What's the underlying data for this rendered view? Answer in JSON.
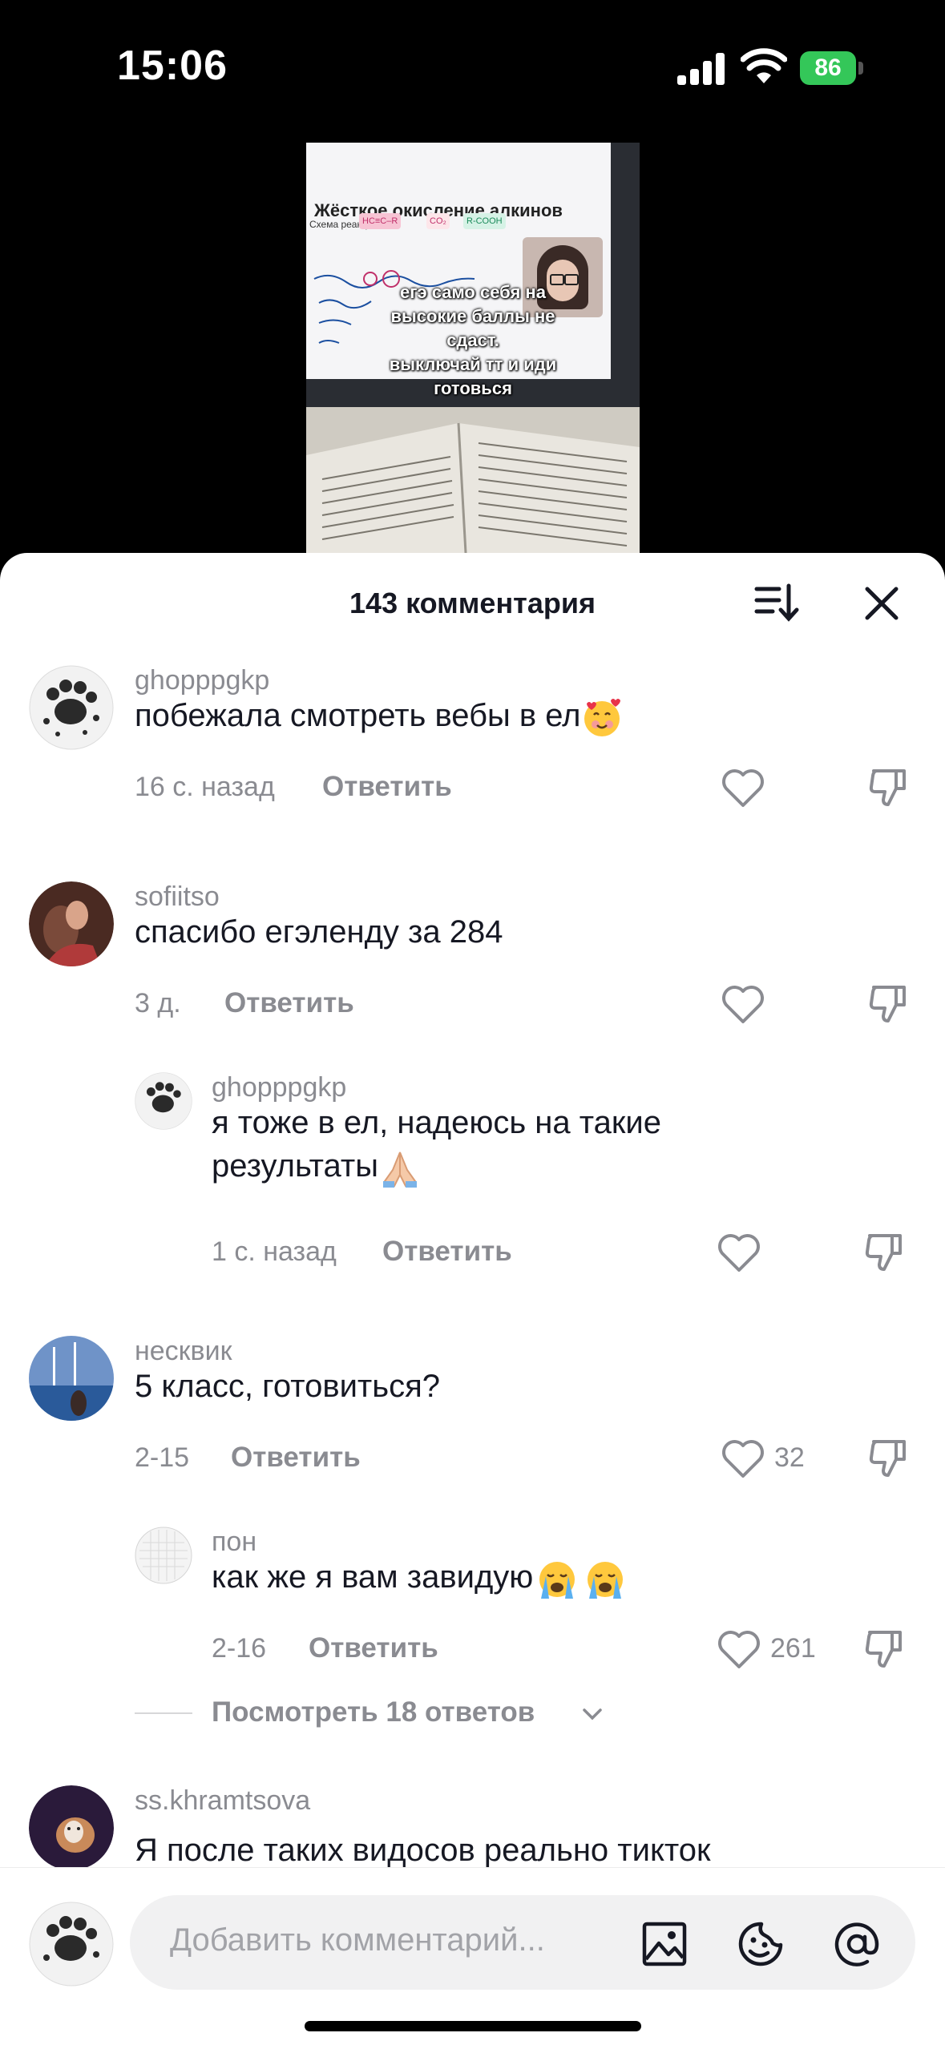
{
  "status_bar": {
    "time": "15:06",
    "battery": "86"
  },
  "video": {
    "slide_title": "Жёсткое окисление алкинов",
    "slide_sub": "Схема реакции:",
    "overlay_lines": [
      "егэ само себя на",
      "высокие баллы не",
      "сдаст.",
      "выключай тт и иди",
      "готовься"
    ]
  },
  "panel": {
    "title": "143 комментария"
  },
  "comments": [
    {
      "username": "ghopppgkp",
      "text": "побежала смотреть вебы в ел",
      "emoji": "smiling-face-with-hearts",
      "time": "16 с. назад",
      "reply_label": "Ответить",
      "likes": ""
    },
    {
      "username": "sofiitso",
      "text": "спасибо егэленду за 284",
      "time": "3 д.",
      "reply_label": "Ответить",
      "likes": ""
    },
    {
      "username": "ghopppgkp",
      "text_line1": "я тоже в ел, надеюсь на такие",
      "text_line2": "результаты",
      "emoji": "folded-hands",
      "time": "1 с. назад",
      "reply_label": "Ответить",
      "likes": ""
    },
    {
      "username": "несквик",
      "text": "5 класс, готовиться?",
      "time": "2-15",
      "reply_label": "Ответить",
      "likes": "32"
    },
    {
      "username": "пон",
      "text": "как же я вам завидую",
      "emoji": "loudly-crying-face",
      "time": "2-16",
      "reply_label": "Ответить",
      "likes": "261"
    },
    {
      "username": "ss.khramtsova",
      "text": "Я после таких видосов реально тикток"
    }
  ],
  "view_more": {
    "label": "Посмотреть 18 ответов"
  },
  "composer": {
    "placeholder": "Добавить комментарий..."
  },
  "icons": [
    "sort-icon",
    "close-icon",
    "heart-icon",
    "dislike-icon",
    "image-icon",
    "emoji-icon",
    "mention-icon",
    "chevron-down-icon"
  ]
}
